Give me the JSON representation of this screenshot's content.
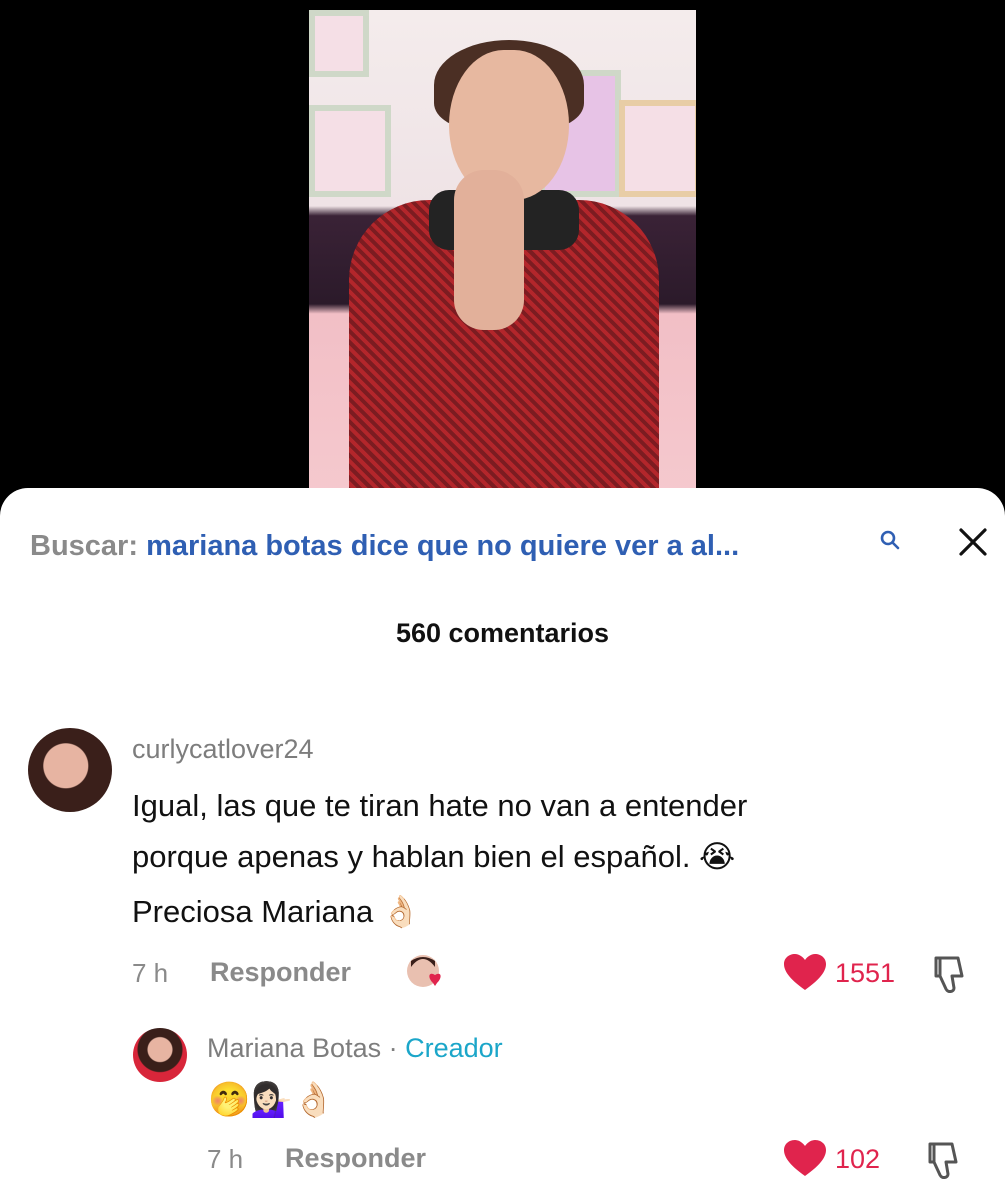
{
  "search": {
    "label": "Buscar:",
    "query": "mariana botas dice que no quiere ver a al..."
  },
  "comments_count": "560 comentarios",
  "comment": {
    "username": "curlycatlover24",
    "lines": [
      "Igual, las que te tiran hate no van a entender",
      "porque apenas y hablan bien el español. 😭"
    ],
    "extra": "Preciosa Mariana 👌🏻",
    "time": "7 h",
    "reply_label": "Responder",
    "likes": "1551"
  },
  "reply": {
    "username": "Mariana Botas",
    "separator": " · ",
    "badge": "Creador",
    "text": "🤭💁🏻‍♀️👌🏻",
    "time": "7 h",
    "reply_label": "Responder",
    "likes": "102"
  },
  "colors": {
    "like_red": "#e0244d",
    "query_blue": "#2f5fb3",
    "creator_cyan": "#1ba6c9"
  }
}
